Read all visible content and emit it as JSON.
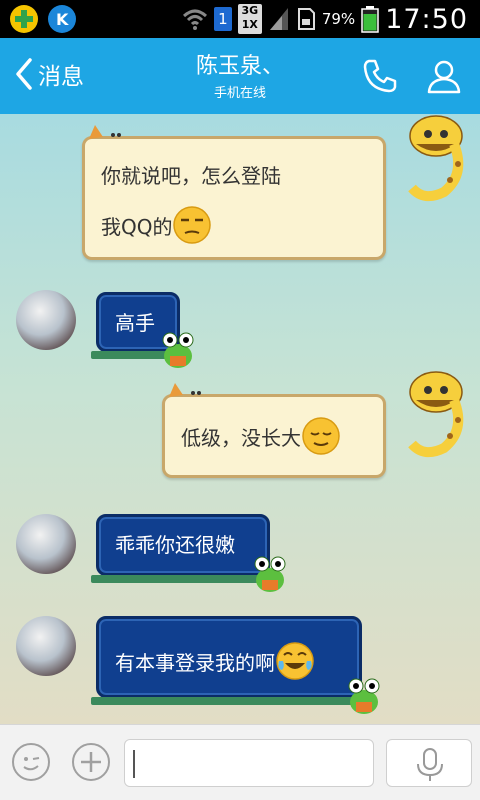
{
  "status_bar": {
    "sim_slot": "1",
    "network": "3G",
    "network_sub": "1X",
    "battery": "79%",
    "time": "17:50"
  },
  "header": {
    "back_label": "消息",
    "title": "陈玉泉、",
    "subtitle": "手机在线",
    "accent_color": "#1ea6e4",
    "icons": [
      "back-chevron-icon",
      "phone-icon",
      "contact-profile-icon"
    ]
  },
  "messages": [
    {
      "side": "right",
      "lines": [
        "你就说吧，怎么登陆",
        "我QQ的"
      ],
      "emoji": "unamused-face"
    },
    {
      "side": "left",
      "lines": [
        "高手"
      ]
    },
    {
      "side": "right",
      "lines": [
        "低级，没长大"
      ],
      "emoji": "relieved-face"
    },
    {
      "side": "left",
      "lines": [
        "乖乖你还很嫩"
      ]
    },
    {
      "side": "left",
      "lines": [
        "有本事登录我的啊"
      ],
      "emoji": "tears-of-joy-face"
    }
  ],
  "input_bar": {
    "text_value": "",
    "icons": [
      "emoji-icon",
      "plus-icon",
      "microphone-icon"
    ]
  }
}
